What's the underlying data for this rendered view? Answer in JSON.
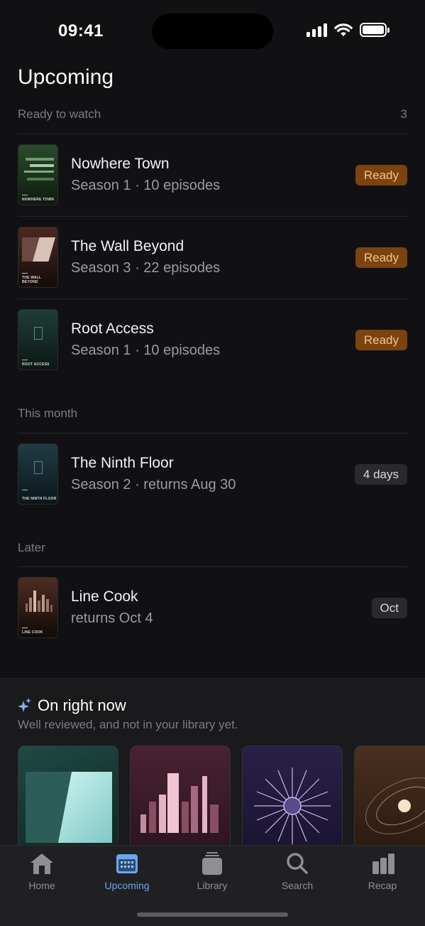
{
  "status": {
    "time": "09:41"
  },
  "page": {
    "title": "Upcoming"
  },
  "sections": {
    "ready": {
      "label": "Ready to watch",
      "count": "3"
    },
    "month": {
      "label": "This month"
    },
    "later": {
      "label": "Later"
    }
  },
  "items": [
    {
      "title": "Nowhere Town",
      "subtitle": "Season 1 · 10 episodes",
      "badge": "Ready",
      "poster_caption": "NOWHERE TOWN"
    },
    {
      "title": "The Wall Beyond",
      "subtitle": "Season 3 · 22 episodes",
      "badge": "Ready",
      "poster_caption": "THE WALL BEYOND"
    },
    {
      "title": "Root Access",
      "subtitle": "Season 1 · 10 episodes",
      "badge": "Ready",
      "poster_caption": "ROOT ACCESS"
    },
    {
      "title": "The Ninth Floor",
      "subtitle": "Season 2 · returns Aug 30",
      "badge": "4 days",
      "poster_caption": "THE NINTH FLOOR"
    },
    {
      "title": "Line Cook",
      "subtitle": "returns Oct 4",
      "badge": "Oct",
      "poster_caption": "LINE COOK"
    }
  ],
  "on_now": {
    "title": "On right now",
    "subtitle": "Well reviewed, and not in your library yet."
  },
  "tabs": [
    {
      "label": "Home",
      "icon": "house-icon"
    },
    {
      "label": "Upcoming",
      "icon": "calendar-icon",
      "active": true
    },
    {
      "label": "Library",
      "icon": "stack-icon"
    },
    {
      "label": "Search",
      "icon": "magnifier-icon"
    },
    {
      "label": "Recap",
      "icon": "bar-chart-icon"
    }
  ],
  "colors": {
    "accent": "#6aa6ee",
    "ready_badge_bg": "#7a4310",
    "ready_badge_text": "#f0c48a",
    "background": "#111113"
  }
}
